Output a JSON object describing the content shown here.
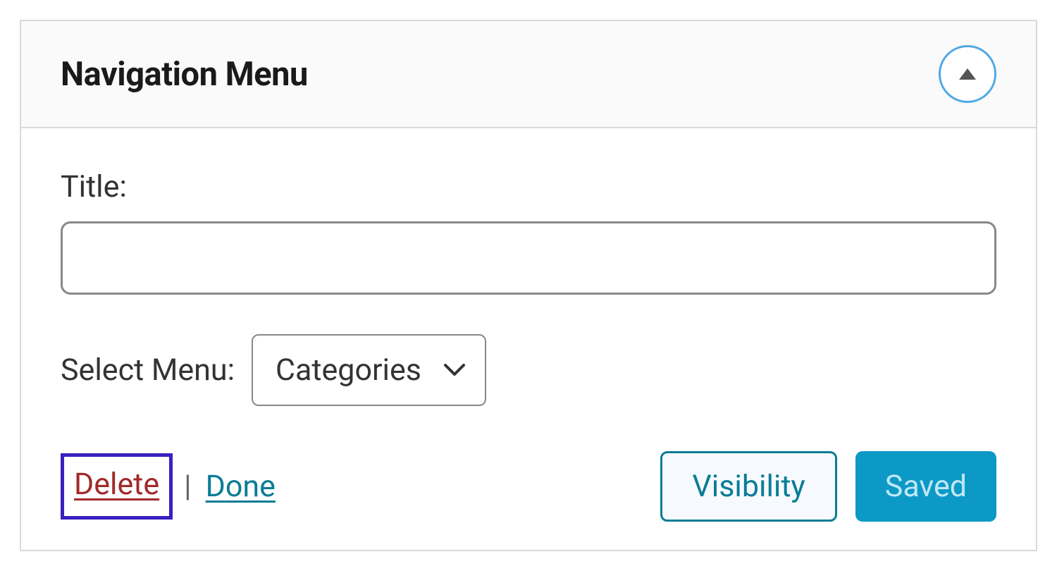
{
  "widget": {
    "title": "Navigation Menu",
    "fields": {
      "title_label": "Title:",
      "title_value": "",
      "select_label": "Select Menu:",
      "select_value": "Categories"
    },
    "actions": {
      "delete_label": "Delete",
      "done_label": "Done",
      "separator": "|",
      "visibility_label": "Visibility",
      "saved_label": "Saved"
    }
  }
}
